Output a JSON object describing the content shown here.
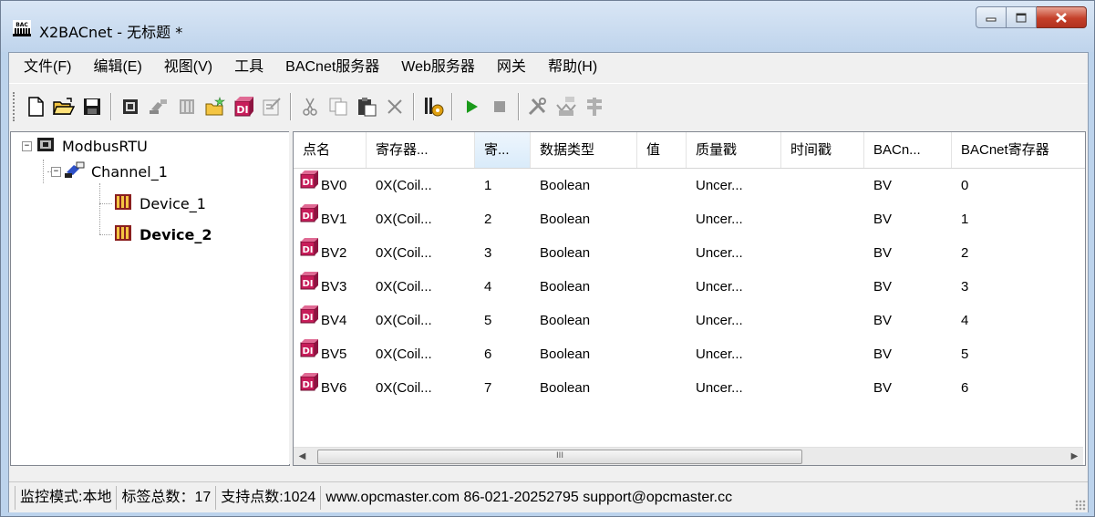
{
  "window": {
    "title": "X2BACnet - 无标题 *",
    "app_icon_text": "BAC"
  },
  "menu": [
    "文件(F)",
    "编辑(E)",
    "视图(V)",
    "工具",
    "BACnet服务器",
    "Web服务器",
    "网关",
    "帮助(H)"
  ],
  "toolbar": {
    "groups": [
      [
        "new-file-icon",
        "open-folder-icon",
        "save-icon"
      ],
      [
        "add-channel-icon",
        "add-device-icon",
        "device-props-icon",
        "add-multiple-icon",
        "add-point-icon",
        "properties-icon"
      ],
      [
        "cut-icon",
        "copy-icon",
        "paste-icon",
        "delete-icon"
      ],
      [
        "simulate-icon"
      ],
      [
        "run-icon",
        "stop-icon"
      ],
      [
        "tools-icon",
        "load-icon",
        "update-icon"
      ]
    ]
  },
  "tree": {
    "root": "ModbusRTU",
    "channel": "Channel_1",
    "devices": [
      "Device_1",
      "Device_2"
    ],
    "selected_device": "Device_2"
  },
  "grid": {
    "columns": [
      "点名",
      "寄存器...",
      "寄...",
      "数据类型",
      "值",
      "质量戳",
      "时间戳",
      "BACn...",
      "BACnet寄存器"
    ],
    "sorted_column": 2,
    "rows": [
      [
        "BV0",
        "0X(Coil...",
        "1",
        "Boolean",
        "",
        "Uncer...",
        "",
        "BV",
        "0"
      ],
      [
        "BV1",
        "0X(Coil...",
        "2",
        "Boolean",
        "",
        "Uncer...",
        "",
        "BV",
        "1"
      ],
      [
        "BV2",
        "0X(Coil...",
        "3",
        "Boolean",
        "",
        "Uncer...",
        "",
        "BV",
        "2"
      ],
      [
        "BV3",
        "0X(Coil...",
        "4",
        "Boolean",
        "",
        "Uncer...",
        "",
        "BV",
        "3"
      ],
      [
        "BV4",
        "0X(Coil...",
        "5",
        "Boolean",
        "",
        "Uncer...",
        "",
        "BV",
        "4"
      ],
      [
        "BV5",
        "0X(Coil...",
        "6",
        "Boolean",
        "",
        "Uncer...",
        "",
        "BV",
        "5"
      ],
      [
        "BV6",
        "0X(Coil...",
        "7",
        "Boolean",
        "",
        "Uncer...",
        "",
        "BV",
        "6"
      ]
    ],
    "row_icon_text": "DI",
    "scroll_thumb_glyph": "III"
  },
  "status": {
    "mode": "监控模式:本地",
    "tag_count": "标签总数：17",
    "support_points": "支持点数:1024",
    "contact": "www.opcmaster.com 86-021-20252795 support@opcmaster.cc"
  },
  "colors": {
    "title_gradient_top": "#d9e6f5",
    "close_button": "#c4402a",
    "run_green": "#1a9a1a",
    "point_icon_red": "#c81d5a"
  }
}
